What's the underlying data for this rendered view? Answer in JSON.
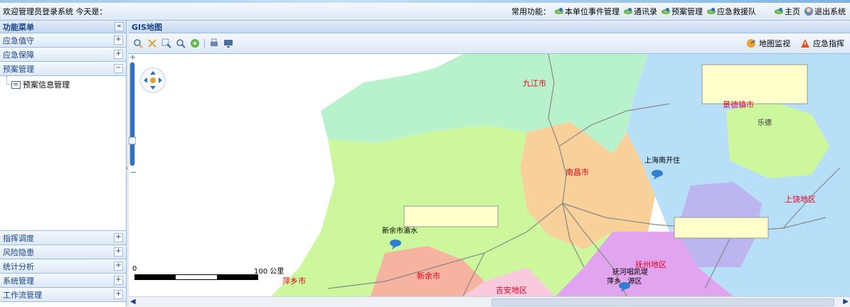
{
  "topbar": {
    "welcome": "欢迎管理员登录系统 今天是：",
    "quick_label": "常用功能：",
    "links": [
      "本单位事件管理",
      "通讯录",
      "预案管理",
      "应急救援队"
    ],
    "home": "主页",
    "logout": "退出系统"
  },
  "sidebar": {
    "title": "功能菜单",
    "collapse_glyph": "«",
    "top_sections": [
      {
        "label": "应急值守",
        "toggle": "+"
      },
      {
        "label": "应急保障",
        "toggle": "+"
      },
      {
        "label": "预案管理",
        "toggle": "−"
      }
    ],
    "tree_item": "预案信息管理",
    "bottom_sections": [
      {
        "label": "指挥调度",
        "toggle": "+"
      },
      {
        "label": "风险隐患",
        "toggle": "+"
      },
      {
        "label": "统计分析",
        "toggle": "+"
      },
      {
        "label": "系统管理",
        "toggle": "+"
      },
      {
        "label": "工作流管理",
        "toggle": "+"
      }
    ]
  },
  "main": {
    "title": "GIS地图",
    "tool_right": [
      "地图监视",
      "应急指挥"
    ]
  },
  "map": {
    "scale_min": "0",
    "scale_max": "100 公里",
    "cities": [
      "九江市",
      "景德镇市",
      "南昌市",
      "上饶地区",
      "抚州地区",
      "新余市",
      "萍乡市",
      "吉安地区"
    ],
    "labels": [
      "乐德",
      "上海南开住",
      "新余市渝水",
      "抚河唱凯堤",
      "萍乡...源区"
    ],
    "city_color": "#e8001b",
    "region_colors": {
      "green": "#b8f2cc",
      "yellow_green": "#cdf79c",
      "orange": "#f7d199",
      "light_blue": "#b7dff8",
      "purple": "#e1a4ee",
      "violet": "#bcb6f0",
      "salmon": "#f6b3a0",
      "pink": "#f9c9de"
    }
  }
}
